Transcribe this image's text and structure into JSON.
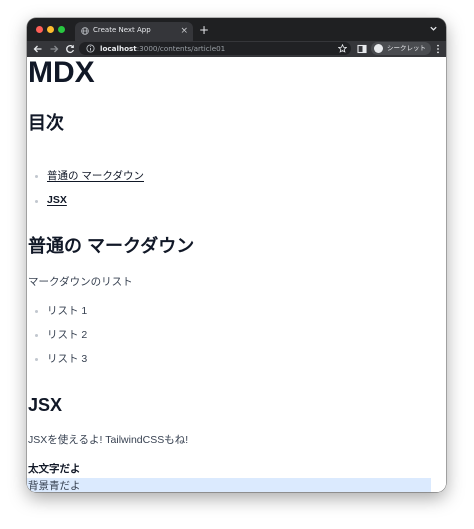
{
  "colors": {
    "tab_strip": "#1f2022",
    "toolbar": "#35363a",
    "omnibox": "#202124",
    "heading": "#111827",
    "body_text": "#374151",
    "bullet": "#c2c7cf",
    "highlight_bg": "#dbeafe"
  },
  "browser": {
    "tab": {
      "title": "Create Next App",
      "close_glyph": "×",
      "favicon": "globe-icon"
    },
    "new_tab_glyph": "+",
    "address": {
      "host": "localhost",
      "path": ":3000/contents/article01"
    },
    "profile_label": "シークレット",
    "icons": [
      "back-arrow-icon",
      "forward-arrow-icon",
      "reload-icon",
      "info-icon",
      "star-icon",
      "side-panel-icon",
      "incognito-icon",
      "kebab-menu-icon",
      "chevron-down-icon"
    ]
  },
  "page": {
    "title": "MDX",
    "toc": {
      "heading": "目次",
      "items": [
        {
          "label": "普通の マークダウン"
        },
        {
          "label": "JSX"
        }
      ]
    },
    "markdown_section": {
      "heading": "普通の マークダウン",
      "paragraph": "マークダウンのリスト",
      "list": [
        "リスト 1",
        "リスト 2",
        "リスト 3"
      ]
    },
    "jsx_section": {
      "heading": "JSX",
      "paragraph": "JSXを使えるよ! TailwindCSSもね!",
      "bold_text": "太文字だよ",
      "blue_bg_text": "背景青だよ"
    }
  }
}
